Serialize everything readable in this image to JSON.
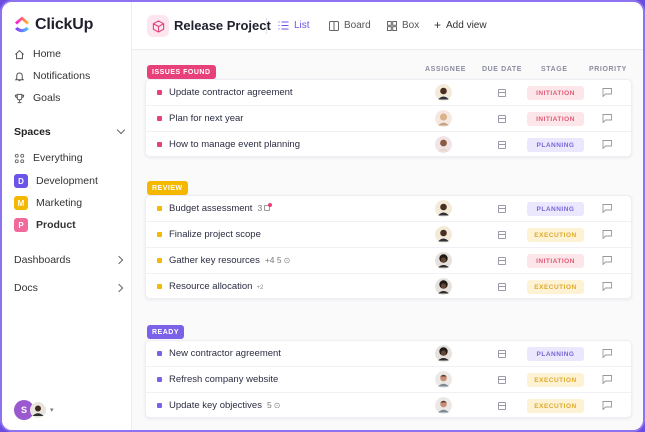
{
  "app": {
    "name": "ClickUp"
  },
  "sidebar": {
    "nav": [
      {
        "label": "Home",
        "icon": "home-icon"
      },
      {
        "label": "Notifications",
        "icon": "bell-icon"
      },
      {
        "label": "Goals",
        "icon": "trophy-icon"
      }
    ],
    "spaces_title": "Spaces",
    "everything_label": "Everything",
    "spaces": [
      {
        "letter": "D",
        "label": "Development",
        "color": "#6b54e8"
      },
      {
        "letter": "M",
        "label": "Marketing",
        "color": "#f5b800"
      },
      {
        "letter": "P",
        "label": "Product",
        "color": "#f06a9b"
      }
    ],
    "dashboards_label": "Dashboards",
    "docs_label": "Docs",
    "user_initial": "S"
  },
  "header": {
    "project_title": "Release Project",
    "views": [
      {
        "label": "List",
        "active": true
      },
      {
        "label": "Board",
        "active": false
      },
      {
        "label": "Box",
        "active": false
      }
    ],
    "add_view_label": "Add view"
  },
  "columns": {
    "assignee": "ASSIGNEE",
    "due_date": "DUE DATE",
    "stage": "STAGE",
    "priority": "PRIORITY"
  },
  "groups": [
    {
      "label": "ISSUES FOUND",
      "color": "#e8417a",
      "tasks": [
        {
          "name": "Update contractor agreement",
          "extra": "",
          "stage": "INITIATION"
        },
        {
          "name": "Plan for next year",
          "extra": "",
          "stage": "INITIATION"
        },
        {
          "name": "How to manage event planning",
          "extra": "",
          "stage": "PLANNING"
        }
      ]
    },
    {
      "label": "REVIEW",
      "color": "#f5b800",
      "tasks": [
        {
          "name": "Budget assessment",
          "extra": "3",
          "stage": "PLANNING"
        },
        {
          "name": "Finalize project scope",
          "extra": "",
          "stage": "EXECUTION"
        },
        {
          "name": "Gather key resources",
          "extra": "+4   5",
          "stage": "INITIATION"
        },
        {
          "name": "Resource allocation",
          "extra": "+2",
          "stage": "EXECUTION"
        }
      ]
    },
    {
      "label": "READY",
      "color": "#7b61e8",
      "tasks": [
        {
          "name": "New contractor agreement",
          "extra": "",
          "stage": "PLANNING"
        },
        {
          "name": "Refresh company website",
          "extra": "",
          "stage": "EXECUTION"
        },
        {
          "name": "Update key objectives",
          "extra": "5",
          "stage": "EXECUTION"
        }
      ]
    }
  ]
}
